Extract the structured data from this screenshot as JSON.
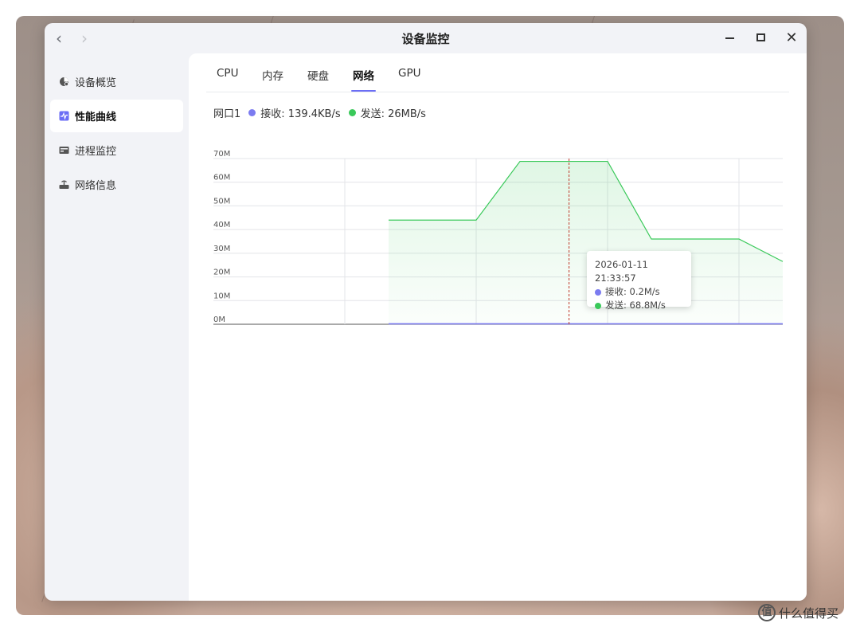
{
  "window": {
    "title": "设备监控",
    "back_label": "‹",
    "forward_label": "›",
    "close_label": "✕"
  },
  "sidebar": {
    "items": [
      {
        "label": "设备概览",
        "icon": "pie-chart-icon",
        "active": false
      },
      {
        "label": "性能曲线",
        "icon": "activity-chart-icon",
        "active": true
      },
      {
        "label": "进程监控",
        "icon": "process-list-icon",
        "active": false
      },
      {
        "label": "网络信息",
        "icon": "router-icon",
        "active": false
      }
    ]
  },
  "tabs": [
    {
      "label": "CPU",
      "active": false
    },
    {
      "label": "内存",
      "active": false
    },
    {
      "label": "硬盘",
      "active": false
    },
    {
      "label": "网络",
      "active": true
    },
    {
      "label": "GPU",
      "active": false
    }
  ],
  "legend": {
    "interface": "网口1",
    "receive_text": "接收: 139.4KB/s",
    "send_text": "发送: 26MB/s",
    "receive_color": "#7b7bf0",
    "send_color": "#3ac95a"
  },
  "tooltip": {
    "time": "2026-01-11 21:33:57",
    "receive": "接收: 0.2M/s",
    "send": "发送: 68.8M/s"
  },
  "chart_data": {
    "type": "area",
    "y_tick_labels": [
      "0M",
      "10M",
      "20M",
      "30M",
      "40M",
      "50M",
      "60M",
      "70M"
    ],
    "ylim": [
      0,
      70
    ],
    "grid": true,
    "series": [
      {
        "name": "发送",
        "color": "#3ac95a",
        "x": [
          0,
          1,
          1.5,
          2.5,
          3.0,
          4.0,
          4.5
        ],
        "values": [
          44,
          44,
          68.8,
          68.8,
          36,
          36,
          26.5
        ]
      },
      {
        "name": "接收",
        "color": "#7b7bf0",
        "x": [
          0,
          1,
          1.5,
          2.5,
          3.0,
          4.0,
          4.5
        ],
        "values": [
          0.2,
          0.2,
          0.2,
          0.2,
          0.2,
          0.2,
          0.2
        ]
      }
    ],
    "crosshair_x": 2.06
  },
  "watermark": {
    "icon_text": "值",
    "text": "什么值得买"
  }
}
